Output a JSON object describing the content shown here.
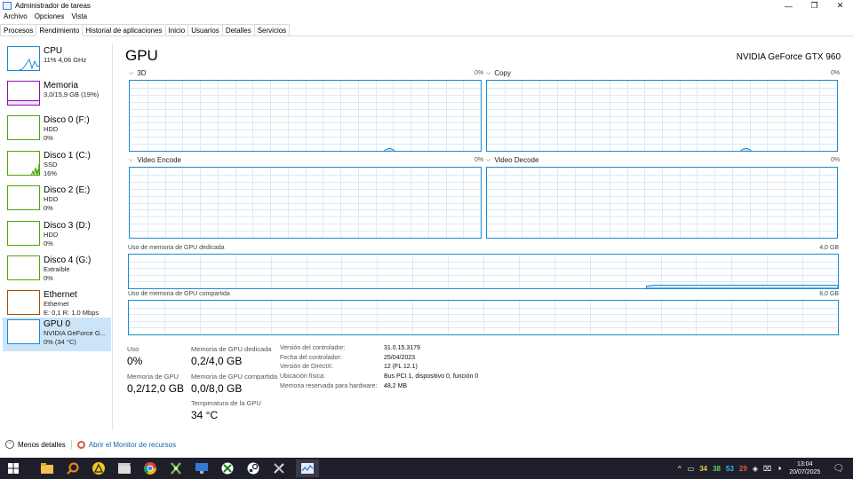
{
  "window": {
    "title": "Administrador de tareas",
    "minimize": "—",
    "maximize": "❐",
    "close": "✕"
  },
  "menu": [
    "Archivo",
    "Opciones",
    "Vista"
  ],
  "tabs": [
    "Procesos",
    "Rendimiento",
    "Historial de aplicaciones",
    "Inicio",
    "Usuarios",
    "Detalles",
    "Servicios"
  ],
  "active_tab": "Rendimiento",
  "sidebar": [
    {
      "name": "CPU",
      "sub1": "11% 4,06 GHz",
      "sub2": "",
      "color": "#1a8bd0"
    },
    {
      "name": "Memoria",
      "sub1": "3,0/15,9 GB (19%)",
      "sub2": "",
      "color": "#8b12ae"
    },
    {
      "name": "Disco 0 (F:)",
      "sub1": "HDD",
      "sub2": "0%",
      "color": "#4da60c"
    },
    {
      "name": "Disco 1 (C:)",
      "sub1": "SSD",
      "sub2": "16%",
      "color": "#4da60c"
    },
    {
      "name": "Disco 2 (E:)",
      "sub1": "HDD",
      "sub2": "0%",
      "color": "#4da60c"
    },
    {
      "name": "Disco 3 (D:)",
      "sub1": "HDD",
      "sub2": "0%",
      "color": "#4da60c"
    },
    {
      "name": "Disco 4 (G:)",
      "sub1": "Extraíble",
      "sub2": "0%",
      "color": "#4da60c"
    },
    {
      "name": "Ethernet",
      "sub1": "Ethernet",
      "sub2": "E: 0,1 R: 1,0 Mbps",
      "color": "#a74f01"
    },
    {
      "name": "GPU 0",
      "sub1": "NVIDIA GeForce G...",
      "sub2": "0% (34 °C)",
      "color": "#1a8bd0"
    }
  ],
  "main": {
    "title": "GPU",
    "model": "NVIDIA GeForce GTX 960",
    "engines": [
      {
        "label": "3D",
        "pct": "0%"
      },
      {
        "label": "Copy",
        "pct": "0%"
      },
      {
        "label": "Video Encode",
        "pct": "0%"
      },
      {
        "label": "Video Decode",
        "pct": "0%"
      }
    ],
    "dedicated": {
      "label": "Uso de memoria de GPU dedicada",
      "max": "4,0 GB"
    },
    "shared": {
      "label": "Uso de memoria de GPU compartida",
      "max": "8,0 GB"
    }
  },
  "stats": {
    "uso_label": "Uso",
    "uso_value": "0%",
    "ded_label": "Memoria de GPU dedicada",
    "ded_value": "0,2/4,0 GB",
    "mem_label": "Memoria de GPU",
    "mem_value": "0,2/12,0 GB",
    "shr_label": "Memoria de GPU compartida",
    "shr_value": "0,0/8,0 GB",
    "temp_label": "Temperatura de la GPU",
    "temp_value": "34 °C"
  },
  "info": [
    {
      "label": "Versión del controlador:",
      "value": "31.0.15.3179"
    },
    {
      "label": "Fecha del controlador:",
      "value": "25/04/2023"
    },
    {
      "label": "Versión de DirectX:",
      "value": "12 (FL 12.1)"
    },
    {
      "label": "Ubicación física:",
      "value": "Bus PCI 1, dispositivo 0, función 0"
    },
    {
      "label": "Memoria reservada para hardware:",
      "value": "48,2 MB"
    }
  ],
  "footer": {
    "less": "Menos detalles",
    "monitor": "Abrir el Monitor de recursos"
  },
  "taskbar": {
    "icons": [
      "windows-start-icon",
      "file-explorer-icon",
      "search-app-icon",
      "warning-app-icon",
      "film-app-icon",
      "chrome-icon",
      "xbox-app-icon",
      "monitor-app-icon",
      "xbox-icon",
      "steam-icon",
      "tools-icon",
      "task-manager-icon"
    ],
    "tray_temps": [
      {
        "text": "34",
        "color": "#e8d13a"
      },
      {
        "text": "38",
        "color": "#5fd35f"
      },
      {
        "text": "53",
        "color": "#38b6f0"
      },
      {
        "text": "29",
        "color": "#f05050"
      }
    ],
    "time": "13:04",
    "date": "20/07/2025"
  }
}
